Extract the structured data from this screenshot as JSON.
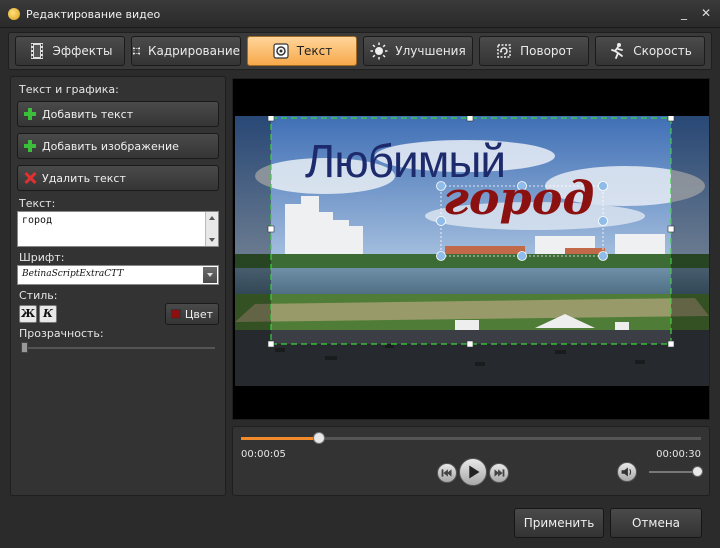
{
  "window": {
    "title": "Редактирование видео",
    "minimize_label": "_",
    "close_label": "✕"
  },
  "tabs": [
    {
      "label": "Эффекты",
      "icon": "film-icon"
    },
    {
      "label": "Кадрирование",
      "icon": "crop-icon"
    },
    {
      "label": "Текст",
      "icon": "text-icon",
      "active": true
    },
    {
      "label": "Улучшения",
      "icon": "sun-icon"
    },
    {
      "label": "Поворот",
      "icon": "rotate-icon"
    },
    {
      "label": "Скорость",
      "icon": "running-man-icon"
    }
  ],
  "left_panel": {
    "section_label": "Текст и графика:",
    "add_text_label": "Добавить текст",
    "add_image_label": "Добавить изображение",
    "delete_text_label": "Удалить текст",
    "text_label": "Текст:",
    "text_value": "город",
    "font_label": "Шрифт:",
    "font_value": "BetinaScriptExtraCTT",
    "style_label": "Стиль:",
    "bold_label": "Ж",
    "italic_label": "К",
    "color_label": "Цвет",
    "text_color": "#8b1010",
    "opacity_label": "Прозрачность:",
    "opacity_value": 0
  },
  "preview": {
    "caption_main": "Любимый",
    "caption_script": "город",
    "caption_main_color": "#1d2a6b",
    "caption_script_color": "#8b1010"
  },
  "playback": {
    "current_time": "00:00:05",
    "total_time": "00:00:30",
    "progress": 0.17,
    "volume": 1.0
  },
  "footer": {
    "apply_label": "Применить",
    "cancel_label": "Отмена"
  }
}
